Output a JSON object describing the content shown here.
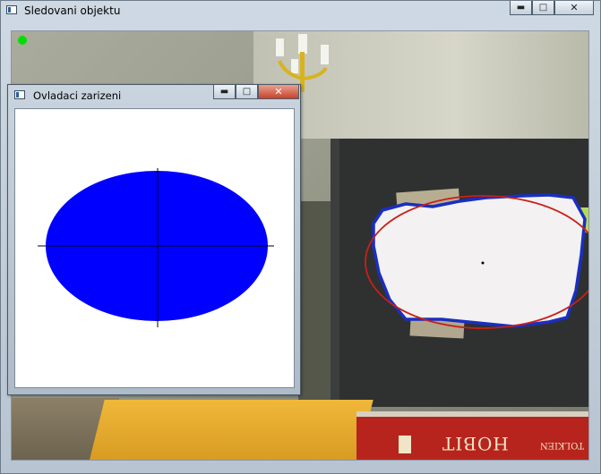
{
  "main_window": {
    "title": "Sledovani objektu",
    "buttons": {
      "minimize": "▬",
      "maximize": "□",
      "close": "✕"
    }
  },
  "control_window": {
    "title": "Ovladaci zarizeni",
    "buttons": {
      "minimize": "▬",
      "maximize": "□",
      "close": "✕"
    },
    "ellipse_color": "#0000ff",
    "axis_color": "#000000"
  },
  "camera": {
    "status_indicator_color": "#00e000",
    "contour_color": "#1a2fbf",
    "fit_ellipse_color": "#c8201a",
    "book_spine": {
      "title": "HOBIT",
      "author": "TOLKIEN"
    }
  },
  "icons": {
    "app": "window-app-icon",
    "minimize": "minimize-icon",
    "maximize": "maximize-icon",
    "close": "close-icon"
  }
}
